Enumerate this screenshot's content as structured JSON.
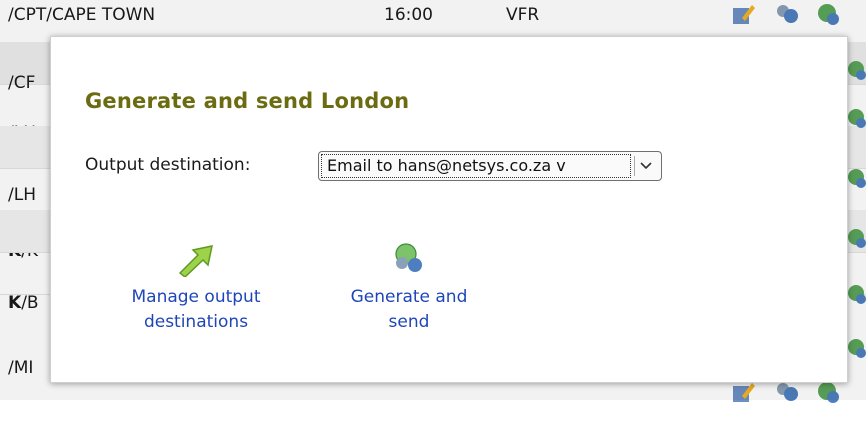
{
  "background": {
    "rows": [
      {
        "route": "/CPT/CAPE TOWN",
        "time": "16:00",
        "type": "VFR"
      },
      {
        "route": "/CF",
        "time": "",
        "type": ""
      },
      {
        "route": "/LH",
        "time": "",
        "type": ""
      },
      {
        "route": "/LH",
        "time": "",
        "type": ""
      },
      {
        "prefix": "K",
        "route": "/K",
        "time": "",
        "type": ""
      },
      {
        "prefix": "K",
        "route": "/B",
        "time": "",
        "type": ""
      },
      {
        "route": "/MI",
        "time": "",
        "type": ""
      }
    ]
  },
  "modal": {
    "title": "Generate and send London",
    "destination": {
      "label": "Output destination:",
      "selected": "Email to hans@netsys.co.za v"
    },
    "actions": {
      "manage": {
        "line1": "Manage output",
        "line2": "destinations",
        "icon": "green-arrow-icon"
      },
      "generate": {
        "line1": "Generate and",
        "line2": "send",
        "icon": "globe-users-icon"
      }
    }
  },
  "colors": {
    "title": "#6b6b12",
    "link": "#1f46b8"
  }
}
